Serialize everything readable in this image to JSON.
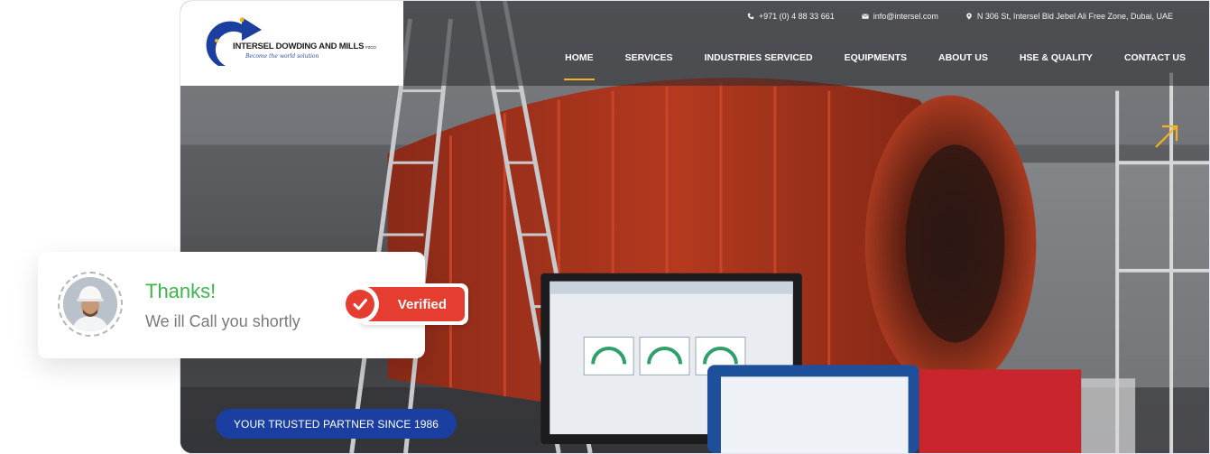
{
  "logo": {
    "name": "INTERSEL DOWDING AND MILLS",
    "suffix": "FZCO",
    "tagline": "Become the world solution",
    "icon": "intersel-swoosh-logo"
  },
  "topbar": {
    "phone": "+971 (0) 4 88 33 661",
    "email": "info@intersel.com",
    "address": "N 306 St, Intersel Bld Jebel Ali Free Zone, Dubai, UAE",
    "icons": [
      "phone-icon",
      "mail-icon",
      "location-pin-icon"
    ]
  },
  "nav": {
    "items": [
      {
        "label": "HOME",
        "active": true
      },
      {
        "label": "SERVICES"
      },
      {
        "label": "INDUSTRIES SERVICED"
      },
      {
        "label": "EQUIPMENTS"
      },
      {
        "label": "ABOUT US"
      },
      {
        "label": "HSE & QUALITY"
      },
      {
        "label": "CONTACT US"
      }
    ]
  },
  "hero": {
    "badge": "YOUR TRUSTED PARTNER SINCE 1986",
    "arrow_icon": "external-arrow-icon"
  },
  "card": {
    "title": "Thanks!",
    "subtitle": "We ill Call you shortly",
    "avatar_icon": "avatar-photo",
    "verified_label": "Verified",
    "verified_icon": "check-icon"
  },
  "colors": {
    "accent": "#f4b21c",
    "brand_blue": "#1a3fa0",
    "success_green": "#3cb54a",
    "verified_red": "#e53d2f"
  }
}
